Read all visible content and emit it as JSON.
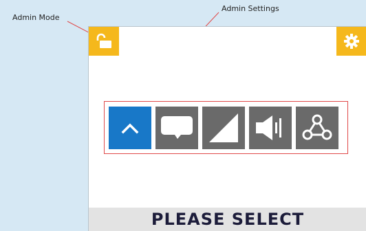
{
  "callouts": {
    "admin_mode": "Admin Mode",
    "admin_settings": "Admin Settings"
  },
  "device": {
    "admin_mode_button": {
      "icon": "unlocked-padlock-icon"
    },
    "settings_button": {
      "icon": "gear-icon"
    },
    "menu": [
      {
        "name": "up-arrow",
        "icon": "chevron-up-icon",
        "active": true
      },
      {
        "name": "speech",
        "icon": "speech-bubble-icon",
        "active": false
      },
      {
        "name": "volume-ramp",
        "icon": "ramp-triangle-icon",
        "active": false
      },
      {
        "name": "speaker",
        "icon": "speaker-icon",
        "active": false
      },
      {
        "name": "network",
        "icon": "network-nodes-icon",
        "active": false
      }
    ],
    "status_text": "PLEASE SELECT"
  },
  "colors": {
    "background": "#d6e8f4",
    "accent_yellow": "#f5b81c",
    "active_blue": "#1878c8",
    "button_gray": "#6a6a6a",
    "highlight_red": "#e04848",
    "status_bar": "#e3e3e3"
  }
}
